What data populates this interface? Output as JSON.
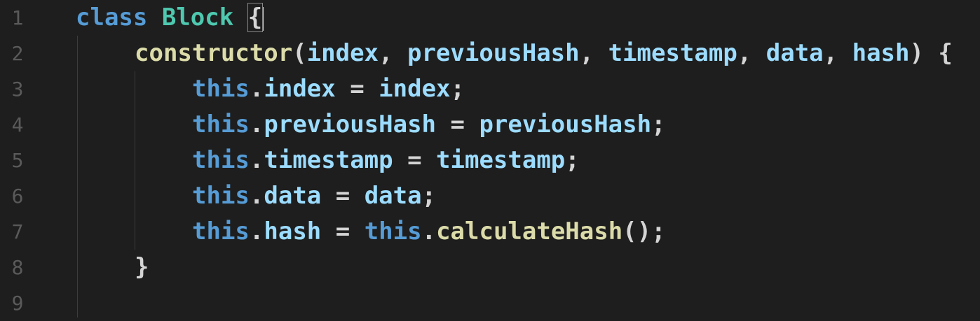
{
  "editor": {
    "line_numbers": [
      "1",
      "2",
      "3",
      "4",
      "5",
      "6",
      "7",
      "8",
      "9"
    ],
    "lines": [
      {
        "tokens": [
          {
            "text": "class",
            "kind": "kw"
          },
          {
            "text": " ",
            "kind": "punc"
          },
          {
            "text": "Block",
            "kind": "cls"
          },
          {
            "text": " ",
            "kind": "punc"
          },
          {
            "text": "{",
            "kind": "brace"
          }
        ]
      },
      {
        "tokens": [
          {
            "text": "constructor",
            "kind": "fn"
          },
          {
            "text": "(",
            "kind": "punc"
          },
          {
            "text": "index",
            "kind": "var"
          },
          {
            "text": ", ",
            "kind": "punc"
          },
          {
            "text": "previousHash",
            "kind": "var"
          },
          {
            "text": ", ",
            "kind": "punc"
          },
          {
            "text": "timestamp",
            "kind": "var"
          },
          {
            "text": ", ",
            "kind": "punc"
          },
          {
            "text": "data",
            "kind": "var"
          },
          {
            "text": ", ",
            "kind": "punc"
          },
          {
            "text": "hash",
            "kind": "var"
          },
          {
            "text": ") {",
            "kind": "punc"
          }
        ]
      },
      {
        "tokens": [
          {
            "text": "this",
            "kind": "kw"
          },
          {
            "text": ".",
            "kind": "punc"
          },
          {
            "text": "index",
            "kind": "prop"
          },
          {
            "text": " = ",
            "kind": "op"
          },
          {
            "text": "index",
            "kind": "var"
          },
          {
            "text": ";",
            "kind": "punc"
          }
        ]
      },
      {
        "tokens": [
          {
            "text": "this",
            "kind": "kw"
          },
          {
            "text": ".",
            "kind": "punc"
          },
          {
            "text": "previousHash",
            "kind": "prop"
          },
          {
            "text": " = ",
            "kind": "op"
          },
          {
            "text": "previousHash",
            "kind": "var"
          },
          {
            "text": ";",
            "kind": "punc"
          }
        ]
      },
      {
        "tokens": [
          {
            "text": "this",
            "kind": "kw"
          },
          {
            "text": ".",
            "kind": "punc"
          },
          {
            "text": "timestamp",
            "kind": "prop"
          },
          {
            "text": " = ",
            "kind": "op"
          },
          {
            "text": "timestamp",
            "kind": "var"
          },
          {
            "text": ";",
            "kind": "punc"
          }
        ]
      },
      {
        "tokens": [
          {
            "text": "this",
            "kind": "kw"
          },
          {
            "text": ".",
            "kind": "punc"
          },
          {
            "text": "data",
            "kind": "prop"
          },
          {
            "text": " = ",
            "kind": "op"
          },
          {
            "text": "data",
            "kind": "var"
          },
          {
            "text": ";",
            "kind": "punc"
          }
        ]
      },
      {
        "tokens": [
          {
            "text": "this",
            "kind": "kw"
          },
          {
            "text": ".",
            "kind": "punc"
          },
          {
            "text": "hash",
            "kind": "prop"
          },
          {
            "text": " = ",
            "kind": "op"
          },
          {
            "text": "this",
            "kind": "kw"
          },
          {
            "text": ".",
            "kind": "punc"
          },
          {
            "text": "calculateHash",
            "kind": "fn"
          },
          {
            "text": "();",
            "kind": "punc"
          }
        ]
      },
      {
        "tokens": [
          {
            "text": "}",
            "kind": "punc"
          }
        ]
      },
      {
        "tokens": []
      }
    ]
  },
  "colors": {
    "background": "#1e1e1e",
    "keyword": "#569cd6",
    "class_name": "#4ec9b0",
    "function": "#dcdcaa",
    "variable": "#9cdcfe",
    "punctuation": "#d4d4d4",
    "line_number": "#5a5a5a"
  }
}
